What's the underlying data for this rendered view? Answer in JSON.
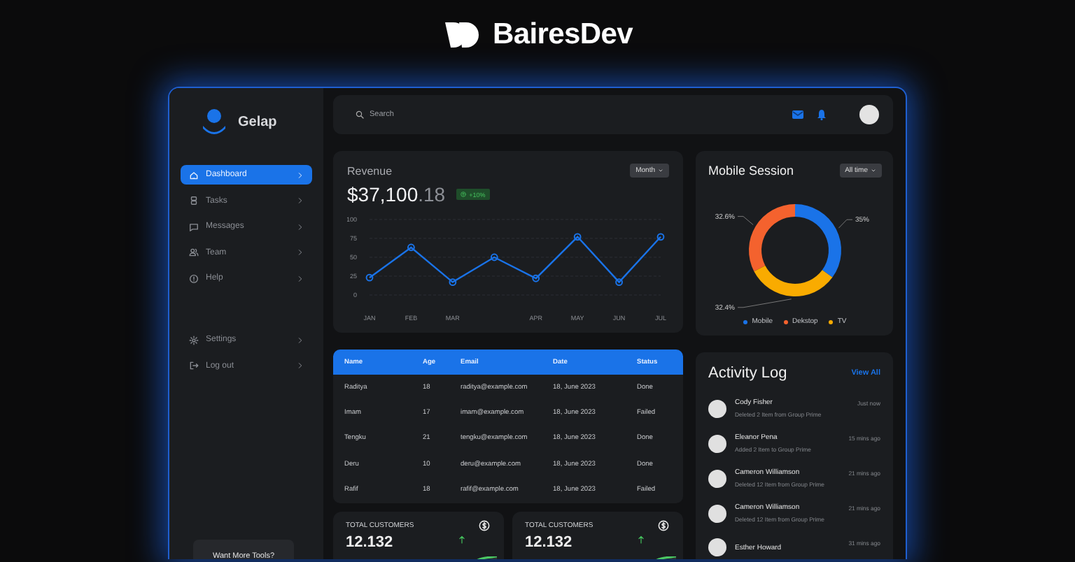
{
  "brand": {
    "name": "BairesDev"
  },
  "sidebar": {
    "app_name": "Gelap",
    "items": [
      {
        "label": "Dashboard",
        "selected": true
      },
      {
        "label": "Tasks",
        "selected": false
      },
      {
        "label": "Messages",
        "selected": false
      },
      {
        "label": "Team",
        "selected": false
      },
      {
        "label": "Help",
        "selected": false
      }
    ],
    "footer_items": [
      {
        "label": "Settings",
        "selected": false
      },
      {
        "label": "Log out",
        "selected": false
      }
    ],
    "promo": {
      "text": "Want More Tools?"
    }
  },
  "topbar": {
    "search": {
      "placeholder": "Search"
    }
  },
  "revenue": {
    "title": "Revenue",
    "period": "Month",
    "amount": "$37,100",
    "amount_decimal": ".18",
    "change": "+10%",
    "chart_data": {
      "type": "line",
      "grid": true,
      "categories": [
        "JAN",
        "FEB",
        "MAR",
        null,
        "APR",
        "MAY",
        "JUN",
        "JUL"
      ],
      "ylim": [
        0,
        100
      ],
      "yticks": [
        0,
        25,
        50,
        75,
        100
      ],
      "series": [
        {
          "color": "#1a73e8",
          "marker": "circle",
          "values": [
            23,
            63,
            17,
            50,
            22,
            77,
            17,
            77
          ]
        }
      ]
    }
  },
  "mobile_session": {
    "title": "Mobile Session",
    "period": "All time",
    "chart_data": {
      "type": "donut",
      "categories": [
        "Mobile",
        "Dekstop",
        "TV"
      ],
      "colors": [
        "#1a73e8",
        "#f4622e",
        "#f9ab00"
      ],
      "value_labels": [
        "35%",
        "32.6%",
        "32.4%"
      ],
      "series": [
        {
          "values": [
            35,
            32.6,
            32.4
          ]
        }
      ]
    }
  },
  "table": {
    "columns": [
      "Name",
      "Age",
      "Email",
      "Date",
      "Status"
    ],
    "rows": [
      [
        "Raditya",
        "18",
        "raditya@example.com",
        "18, June 2023",
        "Done"
      ],
      [
        "Imam",
        "17",
        "imam@example.com",
        "18, June 2023",
        "Failed"
      ],
      [
        "Tengku",
        "21",
        "tengku@example.com",
        "18, June 2023",
        "Done"
      ],
      [
        "Deru",
        "10",
        "deru@example.com",
        "18, June 2023",
        "Done"
      ],
      [
        "Rafif",
        "18",
        "rafif@example.com",
        "18, June 2023",
        "Failed"
      ]
    ]
  },
  "stats": [
    {
      "title": "TOTAL CUSTOMERS",
      "value": "12.132"
    },
    {
      "title": "TOTAL CUSTOMERS",
      "value": "12.132"
    }
  ],
  "activity": {
    "title": "Activity Log",
    "link": "View All",
    "items": [
      {
        "name": "Cody Fisher",
        "action": "Deleted 2 Item from Group Prime",
        "time": "Just now"
      },
      {
        "name": "Eleanor Pena",
        "action": "Added 2 Item to Group Prime",
        "time": "15 mins ago"
      },
      {
        "name": "Cameron Williamson",
        "action": "Deleted 12 Item from Group Prime",
        "time": "21 mins ago"
      },
      {
        "name": "Cameron Williamson",
        "action": "Deleted 12 Item from Group Prime",
        "time": "21 mins ago"
      },
      {
        "name": "Esther Howard",
        "time": "31 mins ago"
      }
    ]
  }
}
